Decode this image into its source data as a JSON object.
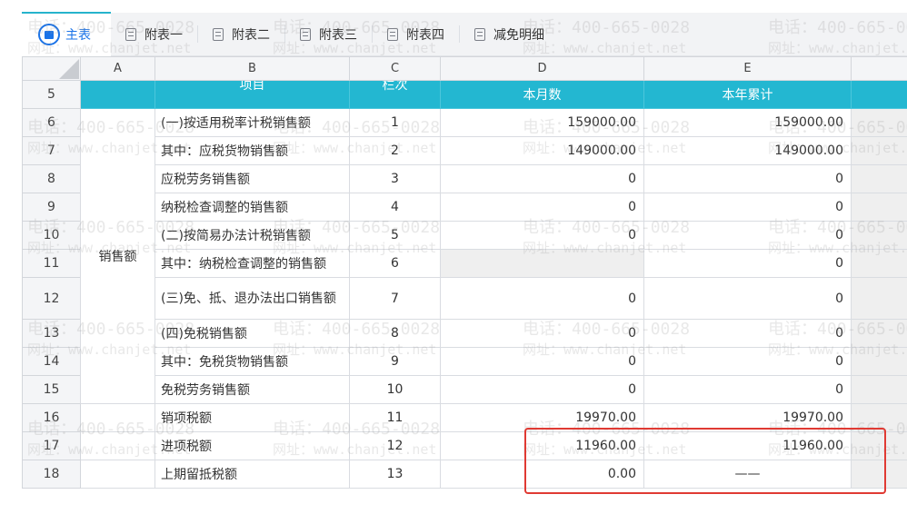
{
  "tabs": [
    {
      "label": "主表",
      "active": true,
      "icon": "main-sheet-icon"
    },
    {
      "label": "附表一",
      "active": false,
      "icon": "sheet-icon"
    },
    {
      "label": "附表二",
      "active": false,
      "icon": "sheet-icon"
    },
    {
      "label": "附表三",
      "active": false,
      "icon": "sheet-icon"
    },
    {
      "label": "附表四",
      "active": false,
      "icon": "sheet-icon"
    },
    {
      "label": "减免明细",
      "active": false,
      "icon": "sheet-icon"
    }
  ],
  "columns": [
    "A",
    "B",
    "C",
    "D",
    "E"
  ],
  "header": {
    "row_num": "5",
    "item": "项目",
    "line": "栏次",
    "month": "本月数",
    "year": "本年累计"
  },
  "group_label": "销售额",
  "rows": [
    {
      "num": "6",
      "item": "(一)按适用税率计税销售额",
      "line": "1",
      "month": "159000.00",
      "year": "159000.00"
    },
    {
      "num": "7",
      "item": "其中：应税货物销售额",
      "line": "2",
      "month": "149000.00",
      "year": "149000.00"
    },
    {
      "num": "8",
      "item": "应税劳务销售额",
      "line": "3",
      "month": "0",
      "year": "0"
    },
    {
      "num": "9",
      "item": "纳税检查调整的销售额",
      "line": "4",
      "month": "0",
      "year": "0"
    },
    {
      "num": "10",
      "item": "(二)按简易办法计税销售额",
      "line": "5",
      "month": "0",
      "year": "0"
    },
    {
      "num": "11",
      "item": "其中：纳税检查调整的销售额",
      "line": "6",
      "month": "",
      "year": "0"
    },
    {
      "num": "12",
      "item": "(三)免、抵、退办法出口销售额",
      "line": "7",
      "month": "0",
      "year": "0"
    },
    {
      "num": "13",
      "item": "(四)免税销售额",
      "line": "8",
      "month": "0",
      "year": "0"
    },
    {
      "num": "14",
      "item": "其中：免税货物销售额",
      "line": "9",
      "month": "0",
      "year": "0"
    },
    {
      "num": "15",
      "item": "免税劳务销售额",
      "line": "10",
      "month": "0",
      "year": "0"
    },
    {
      "num": "16",
      "item": "销项税额",
      "line": "11",
      "month": "19970.00",
      "year": "19970.00"
    },
    {
      "num": "17",
      "item": "进项税额",
      "line": "12",
      "month": "11960.00",
      "year": "11960.00"
    },
    {
      "num": "18",
      "item": "上期留抵税额",
      "line": "13",
      "month": "0.00",
      "year": "——"
    }
  ],
  "watermark": {
    "phone": "电话：400-665-0028",
    "site": "网址：www.chanjet.net"
  },
  "colors": {
    "header_bg": "#23b7d1",
    "accent_blue": "#1a73e8",
    "highlight": "#e03a33"
  }
}
